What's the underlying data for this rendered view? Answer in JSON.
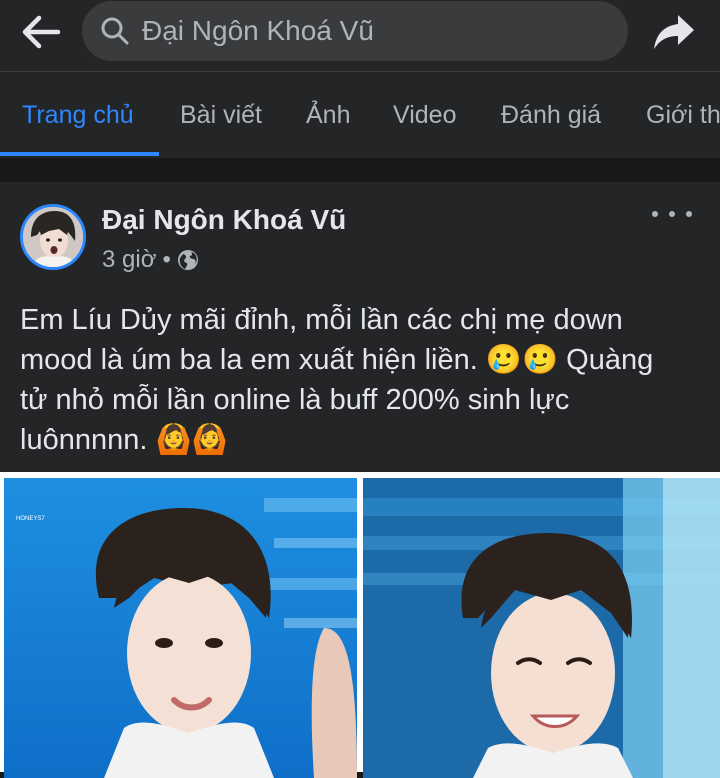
{
  "header": {
    "search_value": "Đại Ngôn Khoá Vũ"
  },
  "tabs": [
    {
      "label": "Trang chủ",
      "active": true
    },
    {
      "label": "Bài viết"
    },
    {
      "label": "Ảnh"
    },
    {
      "label": "Video"
    },
    {
      "label": "Đánh giá"
    },
    {
      "label": "Giới th"
    }
  ],
  "post": {
    "author": "Đại Ngôn Khoá Vũ",
    "time": "3 giờ",
    "separator": "•",
    "text_lines": [
      "Em Líu Dủy mãi đỉnh, mỗi lần các chị mẹ down",
      "mood là úm ba la em xuất hiện liền. 🥲🥲 Quàng",
      "tử nhỏ mỗi lần online là buff 200% sinh lực",
      "luônnnnn. 🙆🙆"
    ]
  },
  "colors": {
    "accent": "#2d88ff",
    "background": "#18191a",
    "surface": "#242526"
  },
  "icons": {
    "back": "back-arrow-icon",
    "search": "search-icon",
    "share": "share-icon",
    "privacy": "globe-icon",
    "more": "more-icon"
  }
}
